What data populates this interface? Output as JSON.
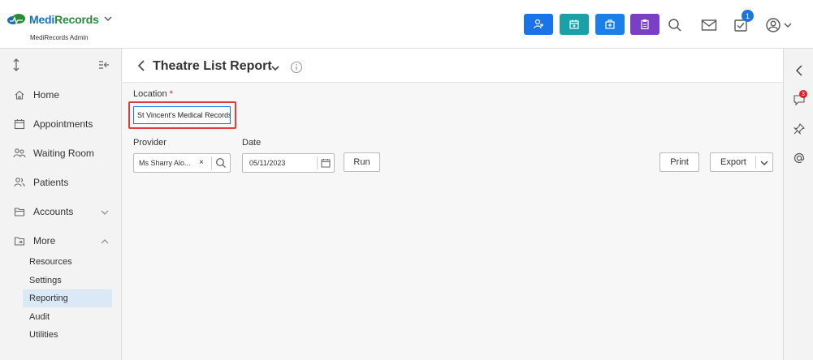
{
  "brand": {
    "name_part1": "Medi",
    "name_part2": "Records",
    "subtitle": "MediRecords Admin"
  },
  "header": {
    "quick_buttons": [
      {
        "name": "add-patient-icon",
        "color": "#1a73e8"
      },
      {
        "name": "calendar-icon",
        "color": "#1aa1a8"
      },
      {
        "name": "medical-kit-icon",
        "color": "#1a7fe8"
      },
      {
        "name": "clipboard-icon",
        "color": "#7b3fc4"
      }
    ],
    "task_badge": "1"
  },
  "sidebar": {
    "items": [
      {
        "label": "Home",
        "icon": "home-icon"
      },
      {
        "label": "Appointments",
        "icon": "calendar-icon"
      },
      {
        "label": "Waiting Room",
        "icon": "people-icon"
      },
      {
        "label": "Patients",
        "icon": "users-icon"
      },
      {
        "label": "Accounts",
        "icon": "folder-icon"
      },
      {
        "label": "More",
        "icon": "folder-arrow-icon"
      }
    ],
    "sub_items": [
      {
        "label": "Resources"
      },
      {
        "label": "Settings"
      },
      {
        "label": "Reporting",
        "active": true
      },
      {
        "label": "Audit"
      },
      {
        "label": "Utilities"
      }
    ]
  },
  "page": {
    "title": "Theatre List Report",
    "location_label": "Location",
    "required_mark": "*",
    "location_value": "St Vincent's Medical Records",
    "provider_label": "Provider",
    "provider_value": "Ms Sharry Alo...",
    "provider_clear": "×",
    "date_label": "Date",
    "date_value": "05/11/2023",
    "run_label": "Run",
    "print_label": "Print",
    "export_label": "Export"
  },
  "rail": {
    "notification_badge": "3"
  }
}
